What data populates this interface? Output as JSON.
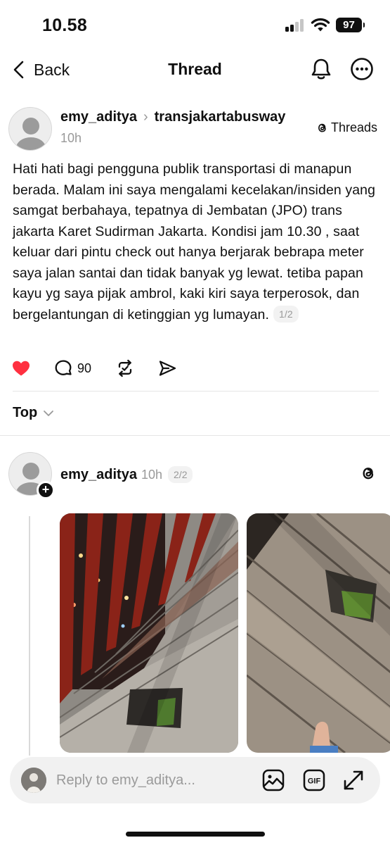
{
  "status_bar": {
    "time": "10.58",
    "battery": "97"
  },
  "nav": {
    "back_label": "Back",
    "title": "Thread"
  },
  "post": {
    "username": "emy_aditya",
    "community": "transjakartabusway",
    "time": "10h",
    "badge_label": "Threads",
    "text": "Hati hati bagi pengguna publik transportasi di manapun berada. Malam ini saya mengalami kecelakan/insiden yang samgat berbahaya, tepatnya di Jembatan (JPO) trans jakarta Karet Sudirman Jakarta. Kondisi jam 10.30 , saat keluar dari pintu check out hanya berjarak bebrapa meter saya jalan santai dan tidak banyak yg lewat. tetiba papan kayu yg saya pijak ambrol, kaki kiri saya terperosok, dan bergelantungan di ketinggian yg lumayan.",
    "page": "1/2",
    "like_color": "#ff3040",
    "comments": "90"
  },
  "sort": {
    "label": "Top"
  },
  "reply": {
    "username": "emy_aditya",
    "time": "10h",
    "page": "2/2"
  },
  "composer": {
    "placeholder": "Reply to emy_aditya..."
  },
  "icons": {
    "back": "chevron-left-icon",
    "bell": "bell-icon",
    "more": "more-icon",
    "like": "heart-icon",
    "comment": "comment-icon",
    "repost": "repost-icon",
    "share": "send-icon",
    "image": "image-icon",
    "gif": "gif-icon",
    "expand": "expand-icon"
  }
}
